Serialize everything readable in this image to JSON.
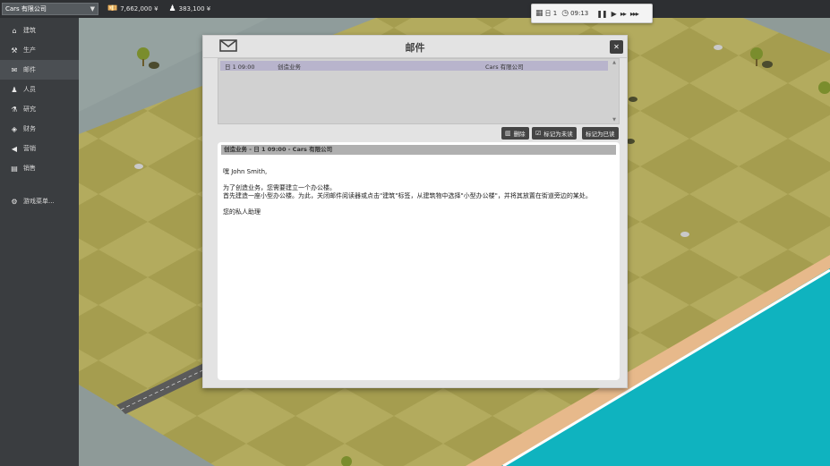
{
  "topbar": {
    "company": "Cars 有限公司",
    "money": "7,662,000 ¥",
    "secondary": "383,100 ¥"
  },
  "time": {
    "day": "日 1",
    "clock": "09:13"
  },
  "sidebar": {
    "items": [
      {
        "label": "建筑",
        "icon": "building-icon"
      },
      {
        "label": "生产",
        "icon": "production-icon"
      },
      {
        "label": "邮件",
        "icon": "mail-icon"
      },
      {
        "label": "人员",
        "icon": "people-icon"
      },
      {
        "label": "研究",
        "icon": "flask-icon"
      },
      {
        "label": "财务",
        "icon": "money-icon"
      },
      {
        "label": "营销",
        "icon": "megaphone-icon"
      },
      {
        "label": "销售",
        "icon": "chart-icon"
      }
    ],
    "menu": {
      "label": "游戏菜单...",
      "icon": "gear-icon"
    }
  },
  "mail": {
    "title": "邮件",
    "inbox": [
      {
        "date": "日 1 09:00",
        "subject": "创造业务",
        "sender": "Cars 有限公司"
      }
    ],
    "buttons": {
      "delete": "删除",
      "mark_unread": "标记为未读",
      "mark_read": "标记为已读"
    },
    "message": {
      "header": "创造业务 - 日 1 09:00 - Cars 有限公司",
      "greeting": "嘿 John Smith,",
      "line1": "为了创造业务，您需要建立一个办公楼。",
      "line2": "首先建造一座小型办公楼。为此，关闭邮件阅读器或点击\"建筑\"标签，从建筑物中选择\"小型办公楼\"，并将其放置在街道旁边的某处。",
      "signature": "您的私人助理"
    }
  }
}
